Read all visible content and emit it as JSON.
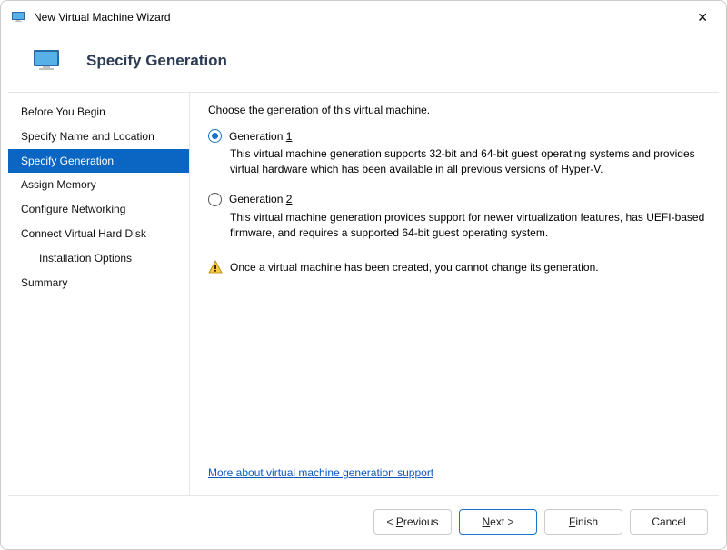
{
  "window": {
    "title": "New Virtual Machine Wizard",
    "close_glyph": "✕"
  },
  "header": {
    "page_title": "Specify Generation"
  },
  "sidebar": {
    "items": [
      {
        "label": "Before You Begin",
        "active": false,
        "indent": false
      },
      {
        "label": "Specify Name and Location",
        "active": false,
        "indent": false
      },
      {
        "label": "Specify Generation",
        "active": true,
        "indent": false
      },
      {
        "label": "Assign Memory",
        "active": false,
        "indent": false
      },
      {
        "label": "Configure Networking",
        "active": false,
        "indent": false
      },
      {
        "label": "Connect Virtual Hard Disk",
        "active": false,
        "indent": false
      },
      {
        "label": "Installation Options",
        "active": false,
        "indent": true
      },
      {
        "label": "Summary",
        "active": false,
        "indent": false
      }
    ]
  },
  "content": {
    "intro": "Choose the generation of this virtual machine.",
    "options": [
      {
        "prefix": "Generation ",
        "mnemonic": "1",
        "checked": true,
        "description": "This virtual machine generation supports 32-bit and 64-bit guest operating systems and provides virtual hardware which has been available in all previous versions of Hyper-V."
      },
      {
        "prefix": "Generation ",
        "mnemonic": "2",
        "checked": false,
        "description": "This virtual machine generation provides support for newer virtualization features, has UEFI-based firmware, and requires a supported 64-bit guest operating system."
      }
    ],
    "warning": "Once a virtual machine has been created, you cannot change its generation.",
    "link": "More about virtual machine generation support"
  },
  "footer": {
    "previous_prefix": "< ",
    "previous_mnemonic": "P",
    "previous_suffix": "revious",
    "next_mnemonic": "N",
    "next_suffix": "ext >",
    "finish_mnemonic": "F",
    "finish_suffix": "inish",
    "cancel": "Cancel"
  }
}
